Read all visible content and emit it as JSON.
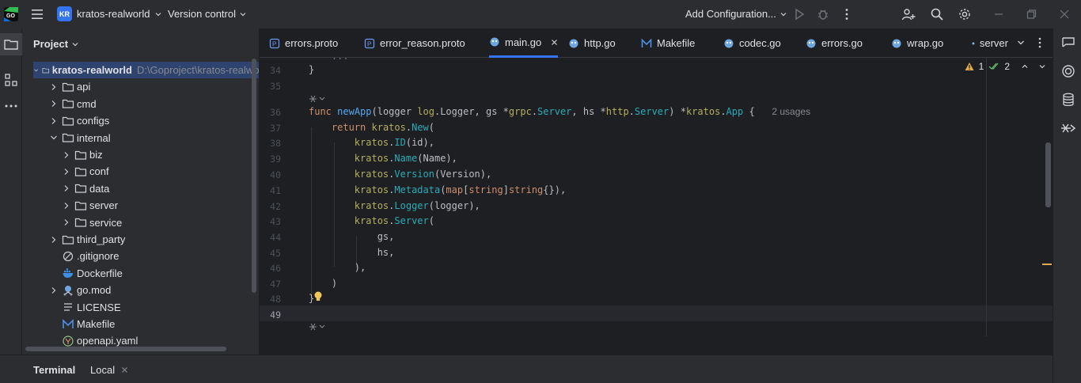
{
  "titlebar": {
    "project_badge": "KR",
    "project_name": "kratos-realworld",
    "vcs_label": "Version control",
    "run_config_label": "Add Configuration..."
  },
  "project_panel": {
    "title": "Project",
    "root_name": "kratos-realworld",
    "root_path": "D:\\Goproject\\kratos-realworld",
    "items": [
      {
        "label": "api",
        "type": "folder"
      },
      {
        "label": "cmd",
        "type": "folder"
      },
      {
        "label": "configs",
        "type": "folder"
      },
      {
        "label": "internal",
        "type": "folder-open"
      },
      {
        "label": "biz",
        "type": "folder"
      },
      {
        "label": "conf",
        "type": "folder"
      },
      {
        "label": "data",
        "type": "folder"
      },
      {
        "label": "server",
        "type": "folder"
      },
      {
        "label": "service",
        "type": "folder"
      },
      {
        "label": "third_party",
        "type": "folder"
      },
      {
        "label": ".gitignore",
        "type": "ignore-file"
      },
      {
        "label": "Dockerfile",
        "type": "docker-file"
      },
      {
        "label": "go.mod",
        "type": "gomod-file"
      },
      {
        "label": "LICENSE",
        "type": "text-file"
      },
      {
        "label": "Makefile",
        "type": "make-file"
      },
      {
        "label": "openapi.yaml",
        "type": "yaml-file"
      }
    ]
  },
  "tabs": [
    {
      "label": "errors.proto",
      "icon": "proto-icon"
    },
    {
      "label": "error_reason.proto",
      "icon": "proto-icon"
    },
    {
      "label": "main.go",
      "icon": "go-icon",
      "active": true
    },
    {
      "label": "http.go",
      "icon": "go-icon"
    },
    {
      "label": "Makefile",
      "icon": "make-icon"
    },
    {
      "label": "codec.go",
      "icon": "go-icon"
    },
    {
      "label": "errors.go",
      "icon": "go-icon"
    },
    {
      "label": "wrap.go",
      "icon": "go-icon"
    },
    {
      "label": "server",
      "icon": "go-icon"
    }
  ],
  "editor": {
    "inspection_warnings": "1",
    "inspection_ok": "2",
    "usages_hint": "2 usages",
    "line_numbers": [
      "34",
      "35",
      "36",
      "37",
      "38",
      "39",
      "40",
      "41",
      "42",
      "43",
      "44",
      "45",
      "46",
      "47",
      "48",
      "49"
    ],
    "code": {
      "l34": "}",
      "l36_func": "func",
      "l36_name": "newApp",
      "l36_p1": "(logger ",
      "l36_pkg1": "log",
      "l36_p2": ".Logger, gs *",
      "l36_pkg2": "grpc",
      "l36_p3": ".",
      "l36_t1": "Server",
      "l36_p4": ", hs *",
      "l36_pkg3": "http",
      "l36_p5": ".",
      "l36_t2": "Server",
      "l36_p6": ") *",
      "l36_pkg4": "kratos",
      "l36_p7": ".",
      "l36_t3": "App",
      "l36_p8": " {",
      "l37_ret": "return",
      "l37_pkg": "kratos",
      "l37_fn": "New",
      "l37_rest": "(",
      "l38_pkg": "kratos",
      "l38_fn": "ID",
      "l38_rest": "(id),",
      "l39_pkg": "kratos",
      "l39_fn": "Name",
      "l39_rest": "(Name),",
      "l40_pkg": "kratos",
      "l40_fn": "Version",
      "l40_rest": "(Version),",
      "l41_pkg": "kratos",
      "l41_fn": "Metadata",
      "l41_a": "(",
      "l41_map": "map",
      "l41_b": "[",
      "l41_s1": "string",
      "l41_c": "]",
      "l41_s2": "string",
      "l41_d": "{}),",
      "l42_pkg": "kratos",
      "l42_fn": "Logger",
      "l42_rest": "(logger),",
      "l43_pkg": "kratos",
      "l43_fn": "Server",
      "l43_rest": "(",
      "l44": "gs,",
      "l45": "hs,",
      "l46": "),",
      "l47": ")",
      "l48": "}"
    }
  },
  "bottom": {
    "terminal_label": "Terminal",
    "local_tab_label": "Local"
  },
  "colors": {
    "accent": "#3574f0",
    "background": "#1e1f22",
    "panel": "#2b2d30"
  }
}
